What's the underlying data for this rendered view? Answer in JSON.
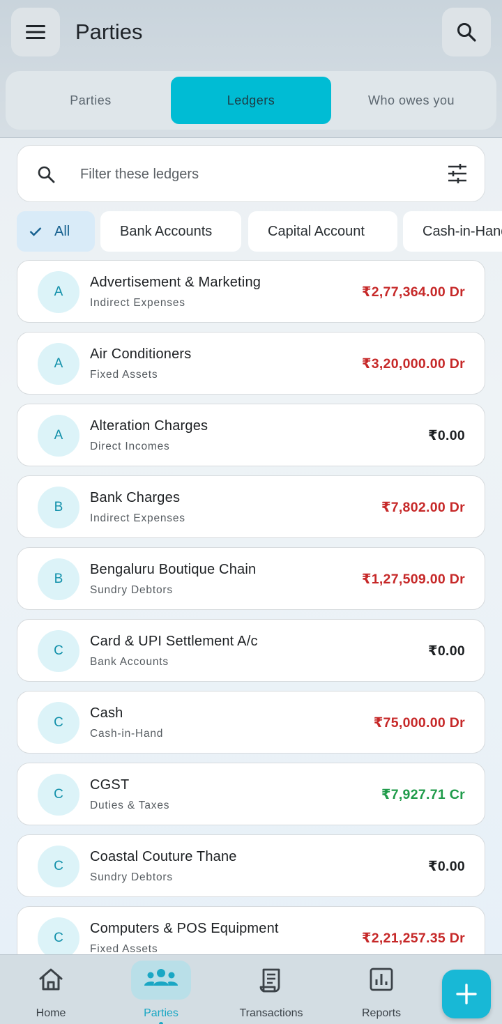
{
  "header": {
    "title": "Parties",
    "menu_icon": "menu-icon",
    "search_icon": "search-icon"
  },
  "tabs": [
    {
      "label": "Parties",
      "active": false
    },
    {
      "label": "Ledgers",
      "active": true
    },
    {
      "label": "Who owes you",
      "active": false
    }
  ],
  "filter": {
    "placeholder": "Filter these ledgers",
    "value": ""
  },
  "chips": [
    {
      "label": "All",
      "selected": true
    },
    {
      "label": "Bank Accounts",
      "selected": false
    },
    {
      "label": "Capital Account",
      "selected": false
    },
    {
      "label": "Cash-in-Hand",
      "selected": false
    }
  ],
  "ledgers": [
    {
      "initial": "A",
      "name": "Advertisement & Marketing",
      "group": "Indirect Expenses",
      "amount": "₹2,77,364.00 Dr",
      "type": "dr"
    },
    {
      "initial": "A",
      "name": "Air Conditioners",
      "group": "Fixed Assets",
      "amount": "₹3,20,000.00 Dr",
      "type": "dr"
    },
    {
      "initial": "A",
      "name": "Alteration Charges",
      "group": "Direct Incomes",
      "amount": "₹0.00",
      "type": "zero"
    },
    {
      "initial": "B",
      "name": "Bank Charges",
      "group": "Indirect Expenses",
      "amount": "₹7,802.00 Dr",
      "type": "dr"
    },
    {
      "initial": "B",
      "name": "Bengaluru Boutique Chain",
      "group": "Sundry Debtors",
      "amount": "₹1,27,509.00 Dr",
      "type": "dr"
    },
    {
      "initial": "C",
      "name": "Card & UPI Settlement A/c",
      "group": "Bank Accounts",
      "amount": "₹0.00",
      "type": "zero"
    },
    {
      "initial": "C",
      "name": "Cash",
      "group": "Cash-in-Hand",
      "amount": "₹75,000.00 Dr",
      "type": "dr"
    },
    {
      "initial": "C",
      "name": "CGST",
      "group": "Duties & Taxes",
      "amount": "₹7,927.71 Cr",
      "type": "cr"
    },
    {
      "initial": "C",
      "name": "Coastal Couture Thane",
      "group": "Sundry Debtors",
      "amount": "₹0.00",
      "type": "zero"
    },
    {
      "initial": "C",
      "name": "Computers & POS Equipment",
      "group": "Fixed Assets",
      "amount": "₹2,21,257.35 Dr",
      "type": "dr"
    }
  ],
  "bottom_nav": [
    {
      "label": "Home",
      "icon": "home-icon",
      "active": false
    },
    {
      "label": "Parties",
      "icon": "people-icon",
      "active": true
    },
    {
      "label": "Transactions",
      "icon": "receipt-icon",
      "active": false
    },
    {
      "label": "Reports",
      "icon": "bar-chart-icon",
      "active": false
    }
  ],
  "fab": {
    "icon": "plus-icon"
  },
  "colors": {
    "accent": "#00bcd4",
    "debit": "#c62828",
    "credit": "#1f9b4a",
    "avatar_bg": "#dcf3f8",
    "avatar_text": "#1190aa"
  }
}
